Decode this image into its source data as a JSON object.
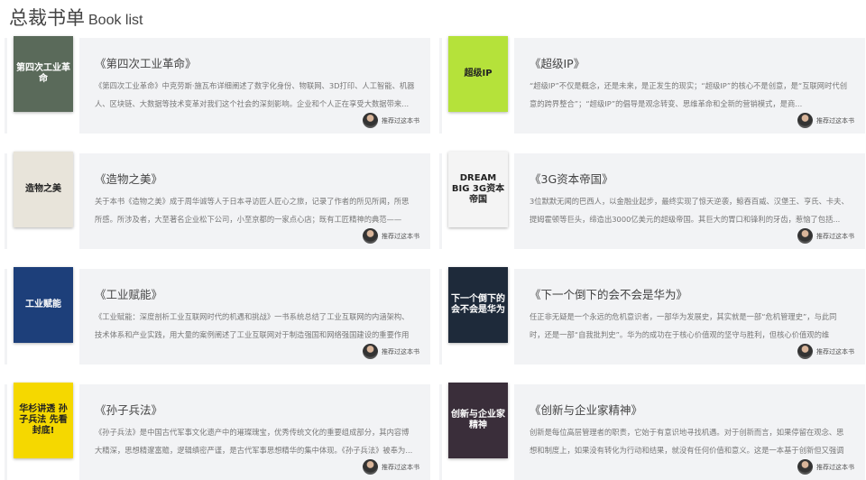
{
  "header": {
    "title": "总裁书单",
    "subtitle": "Book list"
  },
  "recommend_label": "推荐过这本书",
  "books": [
    {
      "title": "《第四次工业革命》",
      "cover_text": "第四次工业革命",
      "cover_color": "#5a6a5a",
      "desc": "《第四次工业革命》中克劳斯·施瓦布详细阐述了数字化身份、物联网、3D打印、人工智能、机器人、区块链、大数据等技术变革对我们这个社会的深刻影响。企业和个人正在享受大数据带来..."
    },
    {
      "title": "《超级IP》",
      "cover_text": "超级IP",
      "cover_color": "#b5e23a",
      "desc": "“超级IP”不仅是概念，还是未来，是正发生的现实；“超级IP”的核心不是创意，是“互联网时代创意的跨界整合”；“超级IP”的倡导是观念转变、思维革命和全新的营销模式，是商..."
    },
    {
      "title": "《造物之美》",
      "cover_text": "造物之美",
      "cover_color": "#e8e4da",
      "desc": "关于本书《造物之美》成于周华诚等人于日本寻访匠人匠心之旅，记录了作者的所见所闻，所思所感。所涉及者，大至著名企业松下公司，小至京都的一家点心店；既有工匠精神的典范——日、..."
    },
    {
      "title": "《3G资本帝国》",
      "cover_text": "DREAM BIG 3G资本帝国",
      "cover_color": "#f4f4f4",
      "desc": "3位默默无闻的巴西人，以金融业起步，最终实现了惊天逆袭，鲸吞百威、汉堡王、亨氏、卡夫、提姆霍顿等巨头，缔造出3000亿美元的超级帝国。其巨大的胃口和锋利的牙齿，惹恼了包括..."
    },
    {
      "title": "《工业赋能》",
      "cover_text": "工业赋能",
      "cover_color": "#1d3f7a",
      "desc": "《工业赋能：深度剖析工业互联网时代的机遇和挑战》一书系统总结了工业互联网的内涵架构、技术体系和产业实践，用大量的案例阐述了工业互联网对于制造强国和网络强国建设的重要作用及..."
    },
    {
      "title": "《下一个倒下的会不会是华为》",
      "cover_text": "下一个倒下的会不会是华为",
      "cover_color": "#1e2a3a",
      "desc": "任正非无疑是一个永远的危机意识者，一部华为发展史，其实就是一部“危机管理史”，与此同时，还是一部“自我批判史”。华为的成功在于核心价值观的坚守与胜利，但核心价值观的维持，..."
    },
    {
      "title": "《孙子兵法》",
      "cover_text": "华杉讲透 孙子兵法 先看封底!",
      "cover_color": "#f5d800",
      "desc": "《孙子兵法》是中国古代军事文化遗产中的璀璨瑰宝，优秀传统文化的重要组成部分，其内容博大精深，思想精邃富赡，逻辑缜密严谨，是古代军事思想精华的集中体现。《孙子兵法》被奉为..."
    },
    {
      "title": "《创新与企业家精神》",
      "cover_text": "创新与企业家精神",
      "cover_color": "#3a2e3a",
      "desc": "创新是每位高层管理者的职责，它始于有意识地寻找机遇。对于创新而言，如果停留在观念、思想和制度上，如果没有转化为行动和结果，就没有任何价值和意义。这是一本基于创新但又强调行..."
    }
  ]
}
